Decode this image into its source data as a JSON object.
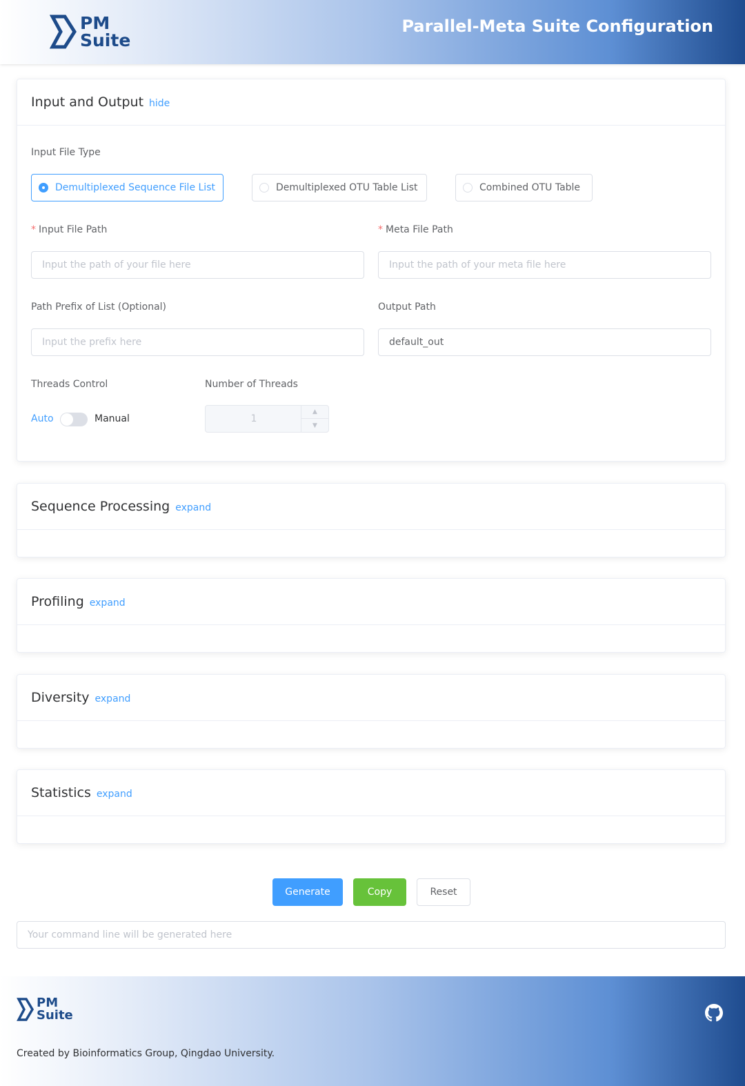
{
  "header": {
    "logo_line1": "PM",
    "logo_line2": "Suite",
    "title": "Parallel-Meta Suite Configuration"
  },
  "sections": [
    {
      "title": "Input and Output",
      "toggle": "hide"
    },
    {
      "title": "Sequence Processing",
      "toggle": "expand"
    },
    {
      "title": "Profiling",
      "toggle": "expand"
    },
    {
      "title": "Diversity",
      "toggle": "expand"
    },
    {
      "title": "Statistics",
      "toggle": "expand"
    }
  ],
  "io": {
    "file_type_label": "Input File Type",
    "file_types": [
      {
        "label": "Demultiplexed Sequence File List",
        "checked": true
      },
      {
        "label": "Demultiplexed OTU Table List",
        "checked": false
      },
      {
        "label": "Combined OTU Table",
        "checked": false
      }
    ],
    "required_mark": "*",
    "input_path": {
      "label": "Input File Path",
      "placeholder": "Input the path of your file here",
      "value": ""
    },
    "meta_path": {
      "label": "Meta File Path",
      "placeholder": "Input the path of your meta file here",
      "value": ""
    },
    "prefix": {
      "label": "Path Prefix of List (Optional)",
      "placeholder": "Input the prefix here",
      "value": ""
    },
    "output_path": {
      "label": "Output Path",
      "placeholder": "",
      "value": "default_out"
    },
    "threads_control": {
      "label": "Threads Control",
      "auto": "Auto",
      "manual": "Manual",
      "manual_on": false
    },
    "threads": {
      "label": "Number of Threads",
      "value": "1",
      "up_icon": "chevron-up-icon",
      "down_icon": "chevron-down-icon"
    }
  },
  "actions": {
    "generate": "Generate",
    "copy": "Copy",
    "reset": "Reset"
  },
  "command": {
    "placeholder": "Your command line will be generated here",
    "value": ""
  },
  "footer": {
    "logo_line1": "PM",
    "logo_line2": "Suite",
    "github_icon": "github-icon",
    "credit": "Created by Bioinformatics Group, Qingdao University."
  },
  "colors": {
    "primary": "#409eff",
    "success": "#67c23a",
    "brand": "#1d4b8a",
    "required": "#f56c6c"
  }
}
